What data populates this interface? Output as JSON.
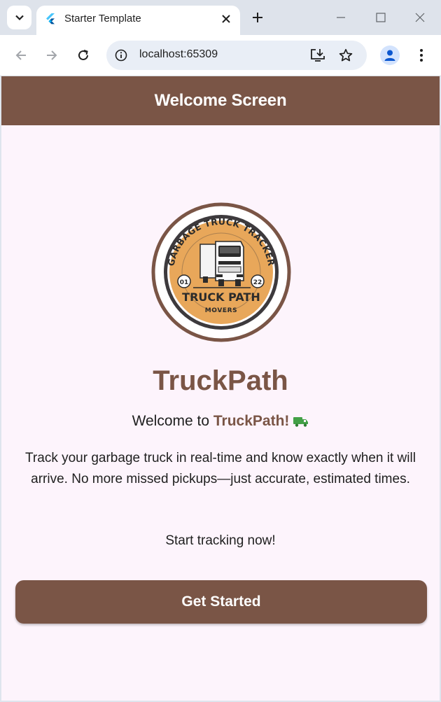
{
  "browser": {
    "tab_title": "Starter Template",
    "url": "localhost:65309"
  },
  "app": {
    "appbar_title": "Welcome Screen",
    "logo": {
      "arc_text": "GARBAGE TRUCK TRACKER",
      "left_badge": "01",
      "right_badge": "22",
      "main_text": "TRUCK PATH",
      "sub_text": "MOVERS"
    },
    "app_name": "TruckPath",
    "welcome_prefix": "Welcome to ",
    "welcome_brand": "TruckPath!",
    "description": "Track your garbage truck in real-time and know exactly when it will arrive. No more missed pickups—just accurate, estimated times.",
    "cta_text": "Start tracking now!",
    "button_label": "Get Started"
  },
  "colors": {
    "primary": "#7a5546",
    "background": "#fdf4fc",
    "logo_orange": "#e8a75a",
    "truck_icon": "#43a047"
  }
}
